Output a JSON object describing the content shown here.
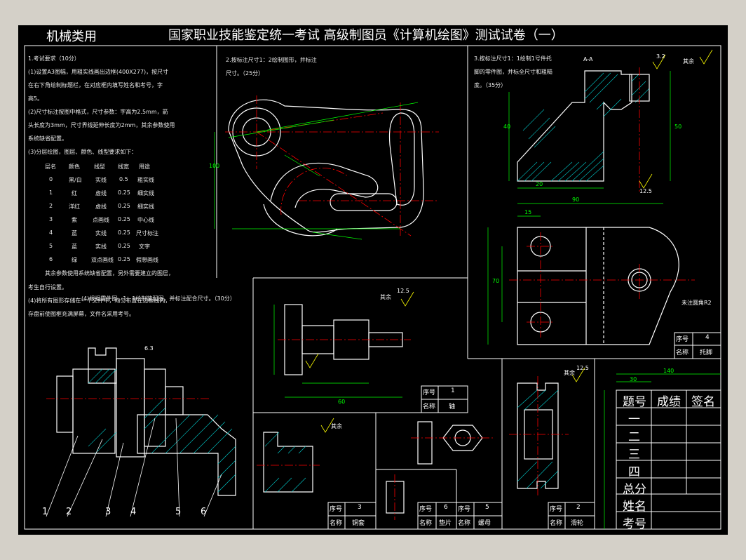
{
  "header": {
    "left_title": "机械类用",
    "main_title": "国家职业技能鉴定统一考试  高级制图员《计算机绘图》测试试卷（一）"
  },
  "requirements": {
    "lines": [
      "1.考试要求（10分）",
      "(1)设置A3图幅，用粗实线画出边框(400X277)，按尺寸",
      "在右下角绘制标题栏，在对应框内填写姓名和考号，字",
      "高5。",
      "(2)尺寸标注按图中格式，尺寸参数：字高为2.5mm，箭",
      "头长度为3mm，尺寸界线延伸长度为2mm，其余参数使用",
      "系统缺省配置。",
      "(3)分层绘图，图层、颜色、线型要求如下："
    ],
    "layer_header": [
      "层名",
      "颜色",
      "线型",
      "线宽",
      "用途"
    ],
    "layers": [
      [
        "0",
        "黑/白",
        "实线",
        "0.5",
        "粗实线"
      ],
      [
        "1",
        "红",
        "虚线",
        "0.25",
        "细实线"
      ],
      [
        "2",
        "洋红",
        "虚线",
        "0.25",
        "细实线"
      ],
      [
        "3",
        "紫",
        "点画线",
        "0.25",
        "中心线"
      ],
      [
        "4",
        "蓝",
        "实线",
        "0.25",
        "尺寸标注"
      ],
      [
        "5",
        "蓝",
        "实线",
        "0.25",
        "文字"
      ],
      [
        "6",
        "绿",
        "双点画线",
        "0.25",
        "假想画线"
      ]
    ],
    "tail": [
      "其余参数使用系统缺省配置，另外需要建立的图层，",
      "考生自行设置。",
      "(4)将所有图形存储在一个文件中，均匀布置在边框线内，",
      "存盘前使图框充满屏幕，文件名采用考号。"
    ]
  },
  "task2": {
    "lines": [
      "2.按标注尺寸1：2绘制图形，并标注",
      "尺寸。（25分）"
    ]
  },
  "task3": {
    "lines": [
      "3.按标注尺寸1：1绘制1号件托",
      "脚的零件图，并标全尺寸和粗糙",
      "度。（35分）"
    ]
  },
  "task4": {
    "lines": [
      "(4)根据零件图，1：1绘制装配图，并标注配合尺寸。（30分）"
    ]
  },
  "annotations": {
    "rest_roughness": "其余",
    "fillet_note": "未注圆角R2",
    "section_aa": "A-A",
    "roughness_32": "3.2",
    "roughness_125": "12.5",
    "roughness_63": "6.3"
  },
  "part_tables": [
    {
      "no_label": "序号",
      "no": "4",
      "name_label": "名称",
      "name": "托脚"
    },
    {
      "no_label": "序号",
      "no": "1",
      "name_label": "名称",
      "name": "轴"
    },
    {
      "no_label": "序号",
      "no": "3",
      "name_label": "名称",
      "name": "铜套"
    },
    {
      "no_label": "序号",
      "no": "6",
      "name_label": "名称",
      "name": "垫片"
    },
    {
      "no_label": "序号",
      "no": "5",
      "name_label": "名称",
      "name": "螺母"
    },
    {
      "no_label": "序号",
      "no": "2",
      "name_label": "名称",
      "name": "滑轮"
    }
  ],
  "balloons": [
    "1",
    "2",
    "3",
    "4",
    "5",
    "6"
  ],
  "score_table": {
    "headers": [
      "题号",
      "成绩",
      "签名"
    ],
    "rows": [
      "一",
      "二",
      "三",
      "四",
      "总分"
    ],
    "name_label": "姓名",
    "id_label": "考号"
  },
  "dims": [
    "140",
    "30",
    "15",
    "90",
    "20",
    "50",
    "70",
    "40",
    "60",
    "100"
  ],
  "colors": {
    "background": "#000000",
    "outline": "#ffffff",
    "dimension": "#00ff00",
    "centerline": "#ff0000",
    "hatch": "#00c0c0",
    "annotation": "#ffff00",
    "frame_surround": "#d4d0c8"
  }
}
